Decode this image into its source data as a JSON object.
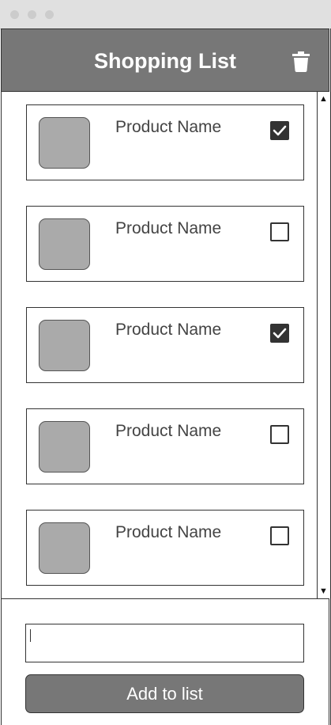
{
  "window": {
    "controls": [
      "close",
      "minimize",
      "maximize"
    ]
  },
  "header": {
    "title": "Shopping List",
    "action_icon": "trash-icon"
  },
  "list": {
    "items": [
      {
        "name": "Product Name",
        "checked": true
      },
      {
        "name": "Product Name",
        "checked": false
      },
      {
        "name": "Product Name",
        "checked": true
      },
      {
        "name": "Product Name",
        "checked": false
      },
      {
        "name": "Product Name",
        "checked": false
      }
    ],
    "scroll_up_icon": "▲",
    "scroll_down_icon": "▼"
  },
  "footer": {
    "input_value": "",
    "add_button_label": "Add to list"
  },
  "colors": {
    "header_bg": "#777777",
    "thumb_bg": "#aaaaaa",
    "checkbox_checked": "#333333"
  }
}
